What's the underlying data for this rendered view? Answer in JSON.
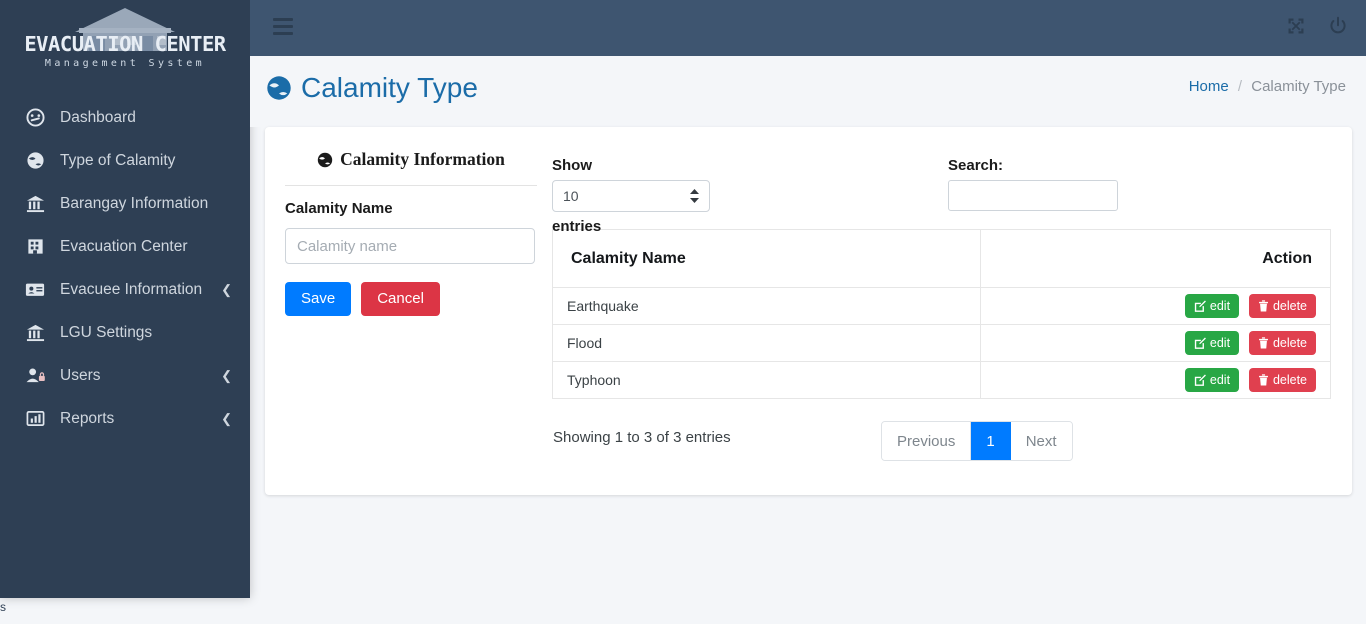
{
  "brand": {
    "title": "EVACUATION CENTER",
    "subtitle": "Management System",
    "logo_icon": "house-icon"
  },
  "sidebar": {
    "items": [
      {
        "label": "Dashboard",
        "icon": "tachometer-icon",
        "caret": ""
      },
      {
        "label": "Type of Calamity",
        "icon": "globe-icon",
        "caret": ""
      },
      {
        "label": "Barangay Information",
        "icon": "bank-icon",
        "caret": ""
      },
      {
        "label": "Evacuation Center",
        "icon": "building-icon",
        "caret": ""
      },
      {
        "label": "Evacuee Information",
        "icon": "id-card-icon",
        "caret": "❮"
      },
      {
        "label": "LGU Settings",
        "icon": "bank-icon",
        "caret": ""
      },
      {
        "label": "Users",
        "icon": "user-lock-icon",
        "caret": "❮"
      },
      {
        "label": "Reports",
        "icon": "chart-bar-icon",
        "caret": "❮"
      }
    ]
  },
  "topbar": {
    "menu_icon": "hamburger-icon",
    "fullscreen_icon": "expand-arrows-icon",
    "power_icon": "power-off-icon"
  },
  "page": {
    "title": "Calamity Type",
    "title_icon": "globe-icon",
    "breadcrumb": {
      "home": "Home",
      "separator": "/",
      "current": "Calamity Type"
    }
  },
  "form": {
    "heading": "Calamity Information",
    "heading_icon": "globe-icon",
    "name_label": "Calamity Name",
    "name_value": "",
    "name_placeholder": "Calamity name",
    "save_label": "Save",
    "cancel_label": "Cancel"
  },
  "table_controls": {
    "show_label": "Show",
    "entries_label": "entries",
    "page_length": "10",
    "search_label": "Search:",
    "search_value": "",
    "search_placeholder": ""
  },
  "table": {
    "columns": [
      "Calamity Name",
      "Action"
    ],
    "rows": [
      {
        "name": "Earthquake",
        "edit_label": "edit",
        "delete_label": "delete"
      },
      {
        "name": "Flood",
        "edit_label": "edit",
        "delete_label": "delete"
      },
      {
        "name": "Typhoon",
        "edit_label": "edit",
        "delete_label": "delete"
      }
    ],
    "info": "Showing 1 to 3 of 3 entries",
    "pagination": {
      "previous": "Previous",
      "current_page": "1",
      "next": "Next"
    }
  },
  "footer": {
    "partial_text": "s"
  },
  "colors": {
    "sidebar": "#2e3f54",
    "topbar": "#3e5570",
    "accent_blue": "#007bff",
    "title_blue": "#1b6ca8",
    "success_green": "#28a745",
    "danger_red": "#dc3545",
    "page_bg": "#f4f6f9"
  }
}
